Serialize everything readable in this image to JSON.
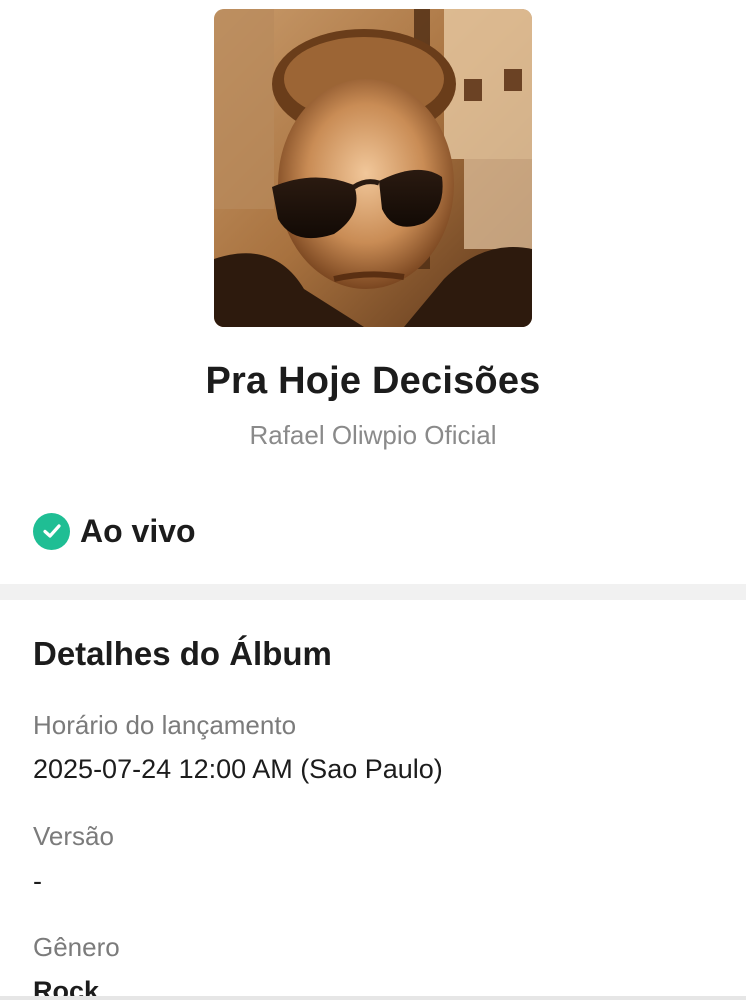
{
  "album": {
    "title": "Pra Hoje Decisões",
    "artist": "Rafael Oliwpio Oficial",
    "cover_description": "sepia-toned selfie"
  },
  "status": {
    "label": "Ao vivo",
    "icon": "check-circle-icon",
    "color": "#1fbe94"
  },
  "details": {
    "section_title": "Detalhes do Álbum",
    "items": [
      {
        "label": "Horário do lançamento",
        "value": "2025-07-24 12:00 AM (Sao Paulo)"
      },
      {
        "label": "Versão",
        "value": "-"
      },
      {
        "label": "Gênero",
        "value": "Rock"
      }
    ]
  }
}
